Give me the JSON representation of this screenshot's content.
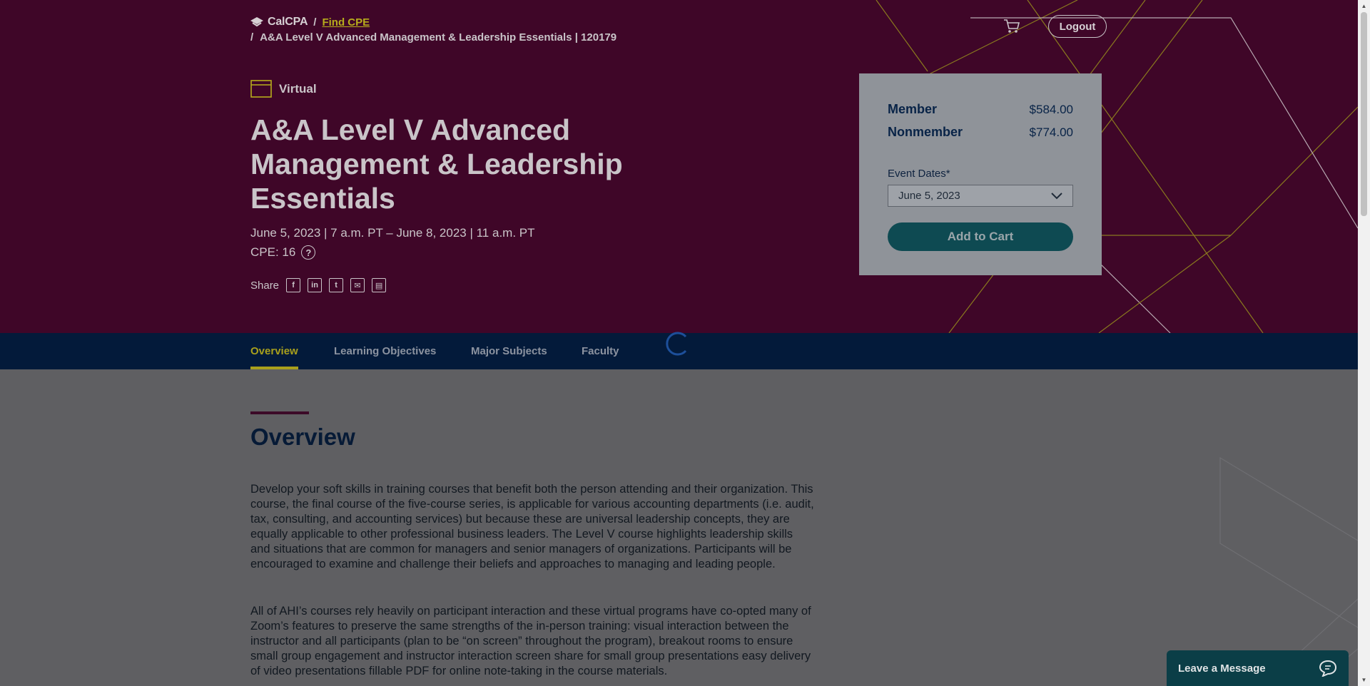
{
  "header": {
    "logo_text": "CalCPA",
    "breadcrumb_sep": "/",
    "breadcrumb_link": "Find CPE",
    "breadcrumb_current": "A&A Level V Advanced Management & Leadership Essentials | 120179",
    "logout_label": "Logout"
  },
  "event": {
    "format": "Virtual",
    "title": "A&A Level V Advanced Management & Leadership Essentials",
    "dates": "June 5, 2023 | 7 a.m. PT – June 8, 2023 | 11 a.m. PT",
    "cpe": "CPE: 16",
    "share_label": "Share",
    "share_icons": [
      "facebook-icon",
      "linkedin-icon",
      "twitter-icon",
      "email-icon",
      "print-icon"
    ]
  },
  "pricing": {
    "member_label": "Member",
    "member_price": "$584.00",
    "nonmember_label": "Nonmember",
    "nonmember_price": "$774.00",
    "dates_label": "Event Dates*",
    "selected_date": "June 5, 2023",
    "add_to_cart": "Add to Cart"
  },
  "tabs": [
    {
      "label": "Overview",
      "active": true
    },
    {
      "label": "Learning Objectives",
      "active": false
    },
    {
      "label": "Major Subjects",
      "active": false
    },
    {
      "label": "Faculty",
      "active": false
    }
  ],
  "overview": {
    "heading": "Overview",
    "paragraph1": "Develop your soft skills in training courses that benefit both the person attending and their organization. This course, the final course of the five-course series, is applicable for various accounting departments (i.e. audit, tax, consulting, and accounting services) but because these are universal leadership concepts, they are equally applicable to other professional business leaders. The Level V course highlights leadership skills and situations that are common for managers and senior managers of organizations. Participants will be encouraged to examine and challenge their beliefs and approaches to managing and leading people.",
    "paragraph2": "All of AHI’s courses rely heavily on participant interaction and these virtual programs have co-opted many of Zoom’s features to preserve the same strengths of the in-person training: visual interaction between the instructor and all participants (plan to be “on screen” throughout the program), breakout rooms to ensure small group engagement and instructor interaction screen share for small group presentations easy delivery of video presentations fillable PDF for online note-taking in the course materials."
  },
  "chat": {
    "label": "Leave a Message"
  },
  "colors": {
    "hero_bg": "#3f0628",
    "nav_bg": "#031a3a",
    "accent": "#a9a01c",
    "button": "#0e4a52"
  }
}
